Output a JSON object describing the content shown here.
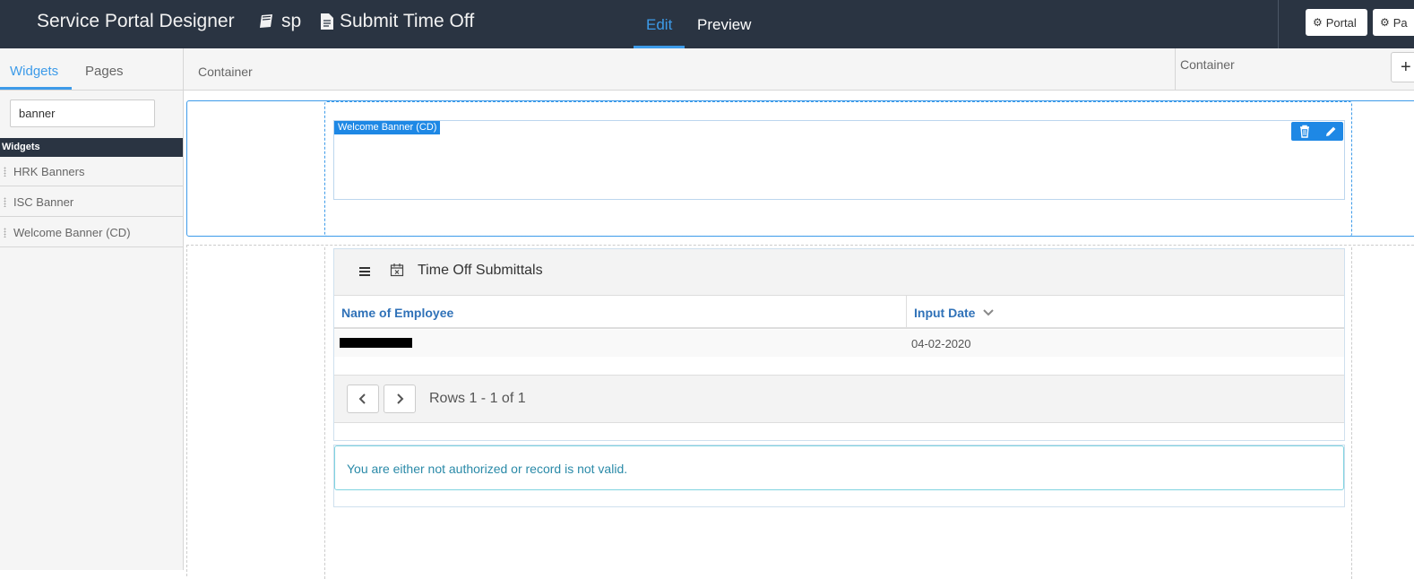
{
  "header": {
    "app_title": "Service Portal Designer",
    "portal_crumb": "sp",
    "page_crumb": "Submit Time Off",
    "tabs": [
      {
        "label": "Edit",
        "active": true
      },
      {
        "label": "Preview",
        "active": false
      }
    ],
    "buttons": [
      "Portal",
      "Pa"
    ],
    "colors": {
      "background": "#2a3442",
      "accent": "#3d9be9"
    }
  },
  "sidebar": {
    "tabs": [
      {
        "label": "Widgets",
        "active": true
      },
      {
        "label": "Pages",
        "active": false
      }
    ],
    "search": {
      "value": "banner",
      "placeholder": ""
    },
    "group_label": "Widgets",
    "items": [
      "HRK Banners",
      "ISC Banner",
      "Welcome Banner (CD)"
    ]
  },
  "container_bar": {
    "label": "Container",
    "right_label": "Container",
    "add_icon": "plus-icon"
  },
  "canvas": {
    "banner_widget": {
      "label": "Welcome Banner (CD)",
      "actions": [
        "trash-icon",
        "pencil-icon"
      ]
    },
    "list_widget": {
      "title": "Time Off Submittals",
      "header_icons": [
        "menu-icon",
        "calendar-x-icon"
      ],
      "columns": [
        "Name of Employee",
        "Input Date"
      ],
      "rows": [
        {
          "name": "",
          "date": "04-02-2020"
        }
      ],
      "pagination_text": "Rows 1 - 1 of 1"
    },
    "alert_text": "You are either not authorized or record is not valid."
  }
}
